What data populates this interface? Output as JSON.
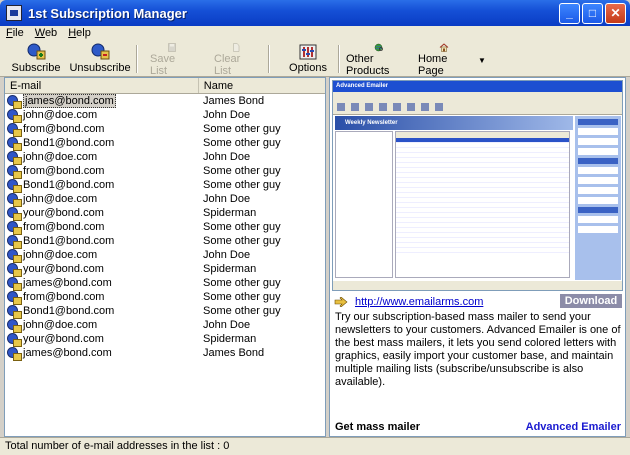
{
  "window": {
    "title": "1st Subscription Manager"
  },
  "menu": [
    {
      "label": "File",
      "u": "F",
      "rest": "ile"
    },
    {
      "label": "Web",
      "u": "W",
      "rest": "eb"
    },
    {
      "label": "Help",
      "u": "H",
      "rest": "elp"
    }
  ],
  "toolbar": {
    "subscribe": "Subscribe",
    "unsubscribe": "Unsubscribe",
    "save_list": "Save List",
    "clear_list": "Clear List",
    "options": "Options",
    "other_products": "Other Products",
    "home_page": "Home Page"
  },
  "list": {
    "headers": [
      "E-mail",
      "Name"
    ],
    "rows": [
      {
        "email": "james@bond.com",
        "name": "James Bond"
      },
      {
        "email": "john@doe.com",
        "name": "John Doe"
      },
      {
        "email": "from@bond.com",
        "name": "Some other guy"
      },
      {
        "email": "Bond1@bond.com",
        "name": "Some other guy"
      },
      {
        "email": "john@doe.com",
        "name": "John Doe"
      },
      {
        "email": "from@bond.com",
        "name": "Some other guy"
      },
      {
        "email": "Bond1@bond.com",
        "name": "Some other guy"
      },
      {
        "email": "john@doe.com",
        "name": "John Doe"
      },
      {
        "email": "your@bond.com",
        "name": "Spiderman"
      },
      {
        "email": "from@bond.com",
        "name": "Some other guy"
      },
      {
        "email": "Bond1@bond.com",
        "name": "Some other guy"
      },
      {
        "email": "john@doe.com",
        "name": "John Doe"
      },
      {
        "email": "your@bond.com",
        "name": "Spiderman"
      },
      {
        "email": "james@bond.com",
        "name": "Some other guy"
      },
      {
        "email": "from@bond.com",
        "name": "Some other guy"
      },
      {
        "email": "Bond1@bond.com",
        "name": "Some other guy"
      },
      {
        "email": "john@doe.com",
        "name": "John Doe"
      },
      {
        "email": "your@bond.com",
        "name": "Spiderman"
      },
      {
        "email": "james@bond.com",
        "name": "James Bond"
      }
    ]
  },
  "ad": {
    "shot_title": "Advanced Emailer",
    "shot_banner": "Weekly Newsletter",
    "link": "http://www.emailarms.com",
    "download": "Download",
    "description": "Try our subscription-based mass mailer to send your newsletters to your customers. Advanced Emailer is one of the best mass mailers, it lets you send colored letters with graphics, easily import your customer base, and maintain multiple mailing lists (subscribe/unsubscribe is also available).",
    "get": "Get mass mailer",
    "brand": "Advanced Emailer"
  },
  "status": "Total number of e-mail addresses in the list : 0"
}
